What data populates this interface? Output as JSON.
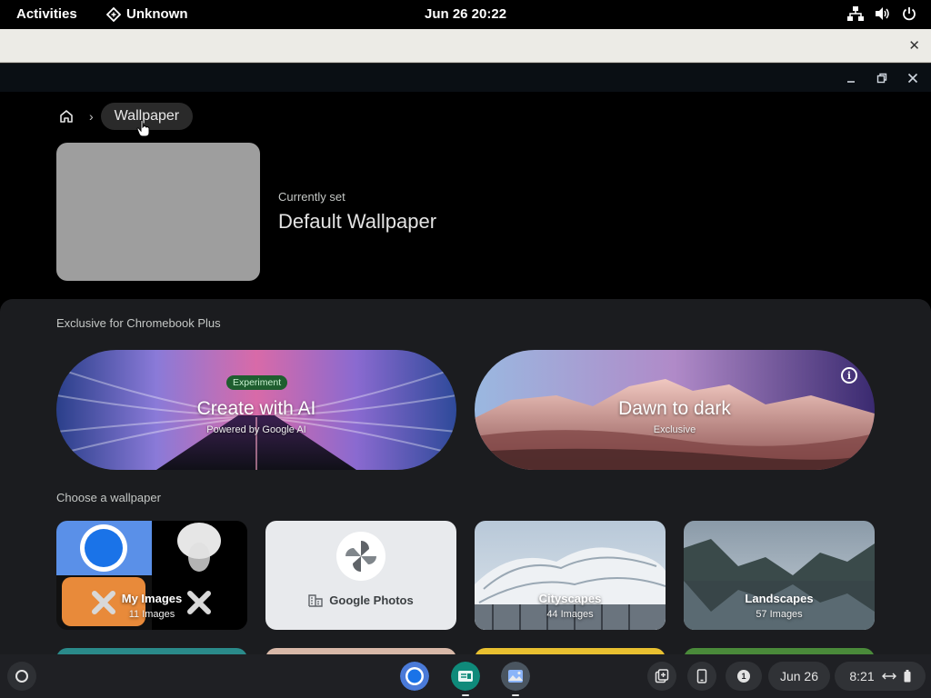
{
  "topbar": {
    "activities": "Activities",
    "app_name": "Unknown",
    "clock": "Jun 26  20:22"
  },
  "window": {
    "breadcrumb": {
      "current": "Wallpaper"
    },
    "current": {
      "label": "Currently set",
      "name": "Default Wallpaper"
    },
    "exclusive_title": "Exclusive for Chromebook Plus",
    "features": [
      {
        "title": "Create with AI",
        "subtitle": "Powered by Google AI",
        "badge": "Experiment"
      },
      {
        "title": "Dawn to dark",
        "subtitle": "Exclusive"
      }
    ],
    "choose_title": "Choose a wallpaper",
    "collections": [
      {
        "name": "My Images",
        "count": "11 Images"
      },
      {
        "name": "Google Photos"
      },
      {
        "name": "Cityscapes",
        "count": "44 Images"
      },
      {
        "name": "Landscapes",
        "count": "57 Images"
      }
    ]
  },
  "shelf": {
    "notification_count": "1",
    "date": "Jun 26",
    "time": "8:21"
  }
}
